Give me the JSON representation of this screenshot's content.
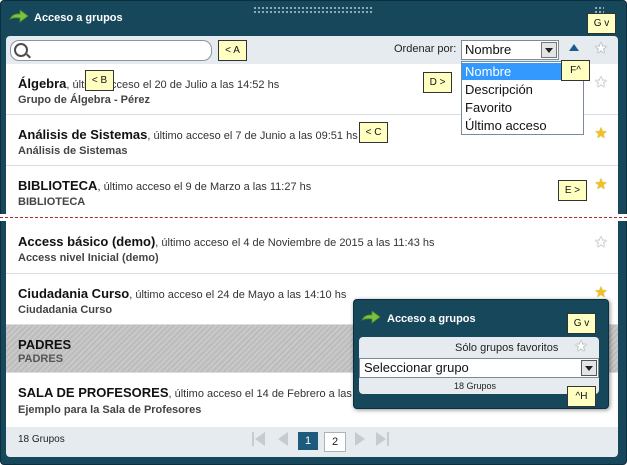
{
  "header": {
    "title": "Acceso a grupos"
  },
  "toolbar": {
    "search_placeholder": "",
    "sort_label": "Ordenar por:",
    "sort_value": "Nombre"
  },
  "sort_options": [
    "Nombre",
    "Descripción",
    "Favorito",
    "Último acceso"
  ],
  "groups": [
    {
      "name": "Álgebra",
      "meta": ", último acceso el 20 de Julio a las 14:52 hs",
      "desc": "Grupo de Álgebra - Pérez",
      "favorite": false
    },
    {
      "name": "Análisis de Sistemas",
      "meta": ", último acceso el 7 de Junio a las 09:51 hs",
      "desc": "Análisis de Sistemas",
      "favorite": true
    },
    {
      "name": "BIBLIOTECA",
      "meta": ", último acceso el 9 de Marzo a las 11:27 hs",
      "desc": "BIBLIOTECA",
      "favorite": true
    },
    {
      "name": "Access básico (demo)",
      "meta": ", último acceso el 4 de Noviembre de 2015 a las 11:43 hs",
      "desc": "Access nivel Inicial (demo)",
      "favorite": false
    },
    {
      "name": "Ciudadania Curso",
      "meta": ", último acceso el 24 de Mayo a las 14:10 hs",
      "desc": "Ciudadania Curso",
      "favorite": true
    },
    {
      "name": "PADRES",
      "meta": "",
      "desc": "PADRES",
      "favorite": false,
      "selected": true
    },
    {
      "name": "SALA DE PROFESORES",
      "meta": ", último acceso el 14 de Febrero a las 1",
      "desc": "Ejemplo para la Sala de Profesores",
      "favorite": false
    }
  ],
  "footer": {
    "count": "18 Grupos",
    "pages": [
      "1",
      "2"
    ],
    "current_page": "1"
  },
  "callouts": {
    "a": "< A",
    "b": "< B",
    "c": "< C",
    "d": "D >",
    "e": "E >",
    "f": "F^",
    "g": "G v",
    "g2": "G v",
    "h": "^H"
  },
  "widget": {
    "title": "Acceso a grupos",
    "favorites_label": "Sólo grupos favoritos",
    "select_value": "Seleccionar grupo",
    "count": "18 Grupos"
  },
  "colors": {
    "frame": "#17475a",
    "panel": "#e6ebef",
    "accent": "#1d5a7c",
    "star_on": "#f2c21b",
    "callout": "#ffffc2"
  }
}
